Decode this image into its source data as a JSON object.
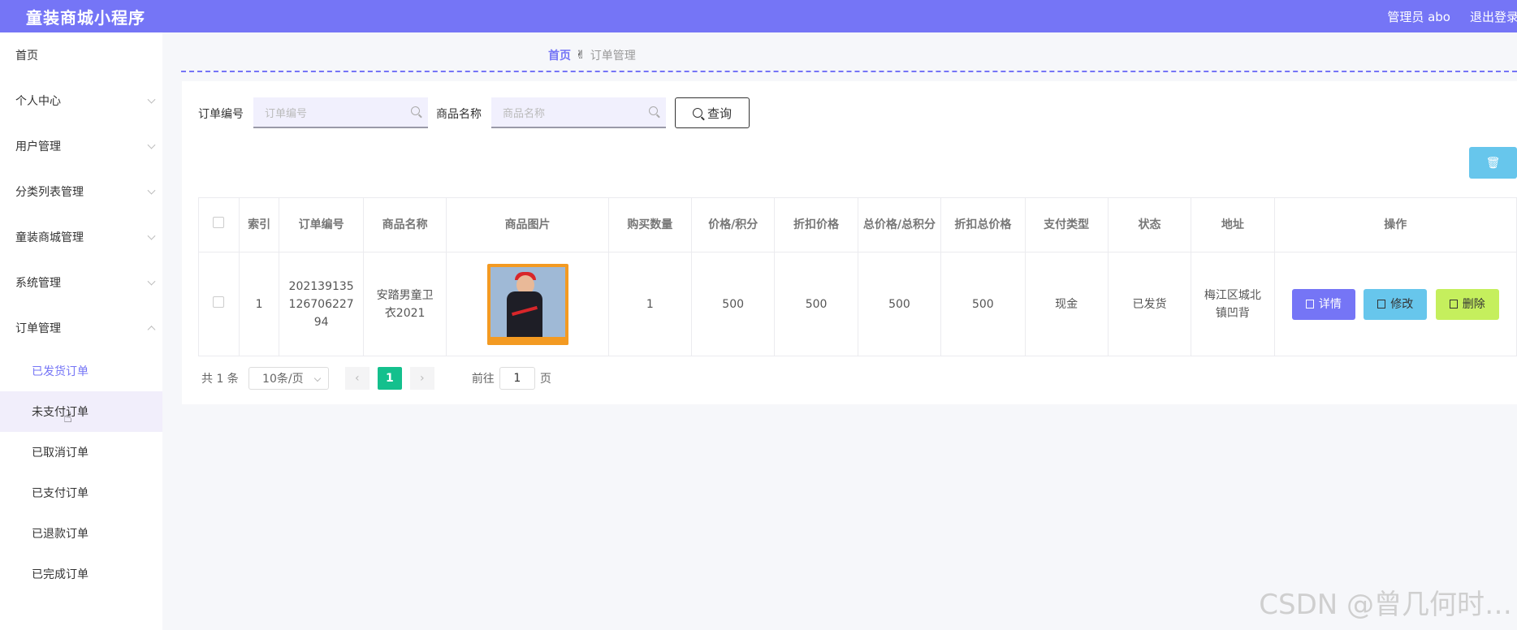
{
  "header": {
    "app_title": "童装商城小程序",
    "admin_label": "管理员 abo",
    "logout_label": "退出登录"
  },
  "sidebar": {
    "items": [
      {
        "label": "首页",
        "has_arrow": false
      },
      {
        "label": "个人中心",
        "has_arrow": true
      },
      {
        "label": "用户管理",
        "has_arrow": true
      },
      {
        "label": "分类列表管理",
        "has_arrow": true
      },
      {
        "label": "童装商城管理",
        "has_arrow": true
      },
      {
        "label": "系统管理",
        "has_arrow": true
      },
      {
        "label": "订单管理",
        "has_arrow": true,
        "expanded": true
      }
    ],
    "submenu": [
      {
        "label": "已发货订单",
        "active": true
      },
      {
        "label": "未支付订单",
        "hover": true
      },
      {
        "label": "已取消订单"
      },
      {
        "label": "已支付订单"
      },
      {
        "label": "已退款订单"
      },
      {
        "label": "已完成订单"
      }
    ]
  },
  "breadcrumb": {
    "home": "首页",
    "separator": "✌",
    "current": "订单管理"
  },
  "search": {
    "order_no_label": "订单编号",
    "order_no_placeholder": "订单编号",
    "product_name_label": "商品名称",
    "product_name_placeholder": "商品名称",
    "query_label": "查询"
  },
  "table": {
    "headers": [
      "",
      "索引",
      "订单编号",
      "商品名称",
      "商品图片",
      "购买数量",
      "价格/积分",
      "折扣价格",
      "总价格/总积分",
      "折扣总价格",
      "支付类型",
      "状态",
      "地址",
      "操作"
    ],
    "rows": [
      {
        "index": "1",
        "order_no": "20213913512670622794",
        "product_name": "安踏男童卫衣2021",
        "quantity": "1",
        "price": "500",
        "discount_price": "500",
        "total_price": "500",
        "discount_total": "500",
        "pay_type": "现金",
        "status": "已发货",
        "address": "梅江区城北镇凹背"
      }
    ],
    "actions": {
      "detail": "详情",
      "edit": "修改",
      "delete": "删除"
    }
  },
  "pagination": {
    "total": "共 1 条",
    "page_size": "10条/页",
    "current_page": "1",
    "goto_label": "前往",
    "goto_value": "1",
    "page_unit": "页"
  },
  "watermark": "CSDN @曾几何时…",
  "colors": {
    "primary": "#7575f6",
    "info": "#67c6ec",
    "danger_soft": "#c5ef5d",
    "page_active": "#14c08d"
  }
}
